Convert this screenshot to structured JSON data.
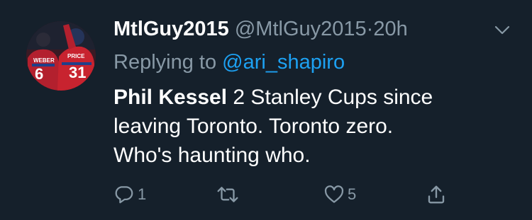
{
  "tweet": {
    "display_name": "MtlGuy2015",
    "handle": "@MtlGuy2015",
    "separator": "·",
    "timestamp": "20h",
    "reply_prefix": "Replying to",
    "reply_to": "@ari_shapiro",
    "text_bold": "Phil Kessel",
    "text_line1_rest": " 2 Stanley Cups since",
    "text_line2": "leaving Toronto. Toronto zero.",
    "text_line3": "Who's haunting who.",
    "avatar": {
      "jersey_left_name": "WEBER",
      "jersey_left_number": "6",
      "jersey_right_name": "PRICE",
      "jersey_right_number": "31"
    }
  },
  "actions": {
    "reply_count": "1",
    "retweet_count": "",
    "like_count": "5"
  },
  "icons": {
    "reply": "reply-icon",
    "retweet": "retweet-icon",
    "like": "heart-icon",
    "share": "share-icon",
    "menu": "chevron-down-icon"
  },
  "colors": {
    "background": "#15202b",
    "secondary_text": "#8899a6",
    "link": "#1da1f2",
    "primary_text": "#ffffff"
  }
}
